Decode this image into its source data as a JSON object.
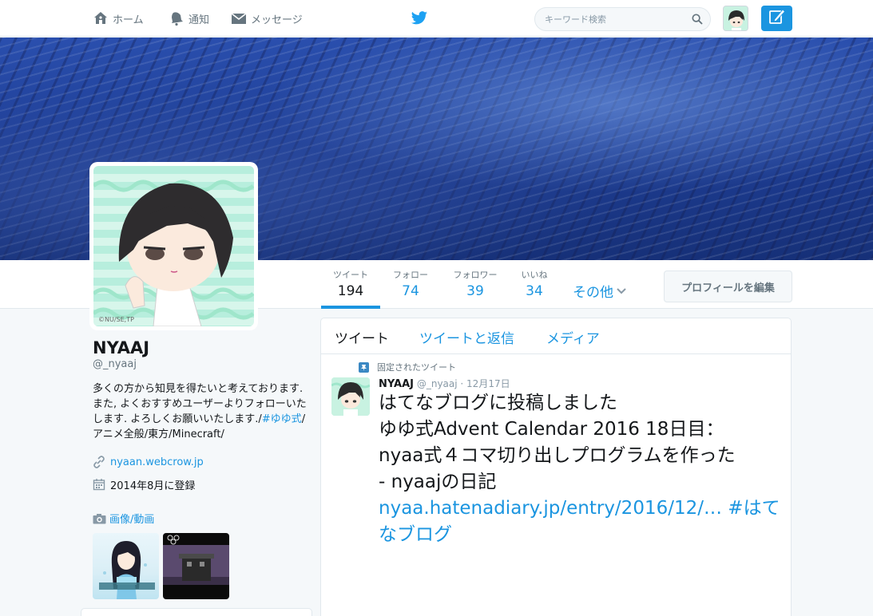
{
  "nav": {
    "home": "ホーム",
    "notifications": "通知",
    "messages": "メッセージ",
    "search_placeholder": "キーワード検索"
  },
  "profile": {
    "name": "NYAAJ",
    "handle": "@_nyaaj",
    "bio": "多くの方から知見を得たいと考えております. また, よくおすすめユーザーよりフォローいたします. よろしくお願いいたします./",
    "bio_tag": "#ゆゆ式",
    "bio_tail": "/アニメ全般/東方/Minecraft/",
    "website": "nyaan.webcrow.jp",
    "joined": "2014年8月に登録",
    "media_label": "画像/動画",
    "avatar_credit": "©NU/SE,TP"
  },
  "stats": {
    "tweets_label": "ツイート",
    "tweets_value": "194",
    "following_label": "フォロー",
    "following_value": "74",
    "followers_label": "フォロワー",
    "followers_value": "39",
    "likes_label": "いいね",
    "likes_value": "34",
    "more_label": "その他",
    "edit_label": "プロフィールを編集"
  },
  "timeline": {
    "tabs": [
      "ツイート",
      "ツイートと返信",
      "メディア"
    ],
    "pinned_label": "固定されたツイート",
    "tweet": {
      "name": "NYAAJ",
      "handle": "@_nyaaj",
      "date": "· 12月17日",
      "line1": "はてなブログに投稿しました",
      "line2": "ゆゆ式Advent Calendar 2016 18日目：",
      "line3": "nyaa式４コマ切り出しプログラムを作った",
      "line4": "- nyaajの日記",
      "link": "nyaa.hatenadiary.jp/entry/2016/12/…",
      "hashtag": "#はてなブログ"
    }
  },
  "colors": {
    "accent": "#1b95e0",
    "text": "#14171a",
    "muted": "#66757f",
    "background": "#f5f8fa",
    "avatar_bg": "#bdeed8"
  },
  "icons": [
    "home-icon",
    "bell-icon",
    "envelope-icon",
    "twitter-bird-icon",
    "search-icon",
    "compose-icon",
    "link-icon",
    "calendar-icon",
    "camera-icon",
    "pin-icon",
    "chevron-down-icon"
  ]
}
